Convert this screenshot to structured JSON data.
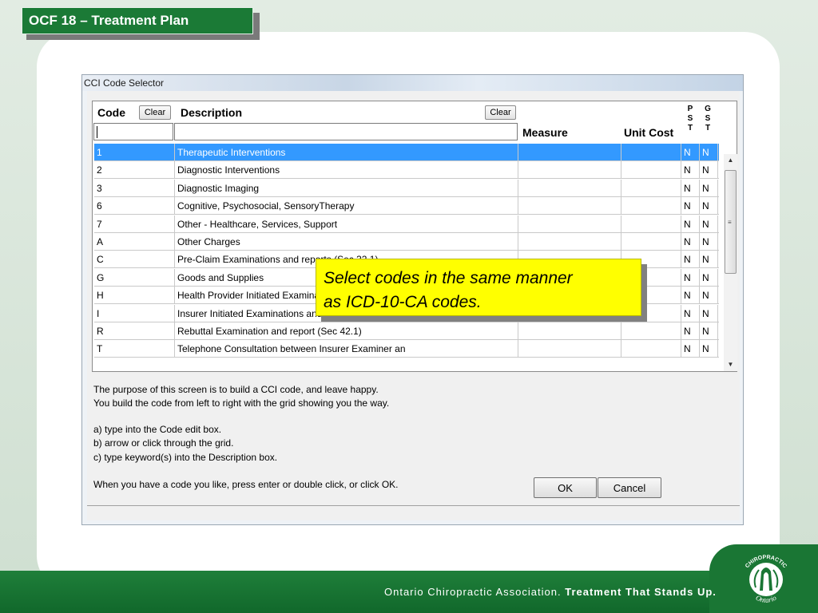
{
  "slide": {
    "title": "OCF 18 – Treatment Plan",
    "footer_org": "Ontario Chiropractic Association.",
    "footer_tagline": "Treatment That Stands Up.",
    "logo_text_top": "CHIROPRACTIC",
    "logo_text_bottom": "Ontario",
    "callout_line1": "Select codes in the same manner",
    "callout_line2": "as ICD-10-CA codes.",
    "colors": {
      "brand_green": "#1b7a36",
      "callout_yellow": "#ffff00",
      "selection_blue": "#3399ff"
    }
  },
  "dialog": {
    "title": "CCI Code Selector",
    "headers": {
      "code": "Code",
      "description": "Description",
      "measure": "Measure",
      "unit_cost": "Unit Cost",
      "pst": "P S T",
      "gst": "G S T"
    },
    "clear_code_label": "Clear",
    "clear_desc_label": "Clear",
    "code_input_value": "",
    "description_input_value": "",
    "rows": [
      {
        "code": "1",
        "description": "Therapeutic Interventions",
        "measure": "",
        "unit_cost": "",
        "pst": "N",
        "gst": "N",
        "selected": true
      },
      {
        "code": "2",
        "description": "Diagnostic Interventions",
        "measure": "",
        "unit_cost": "",
        "pst": "N",
        "gst": "N"
      },
      {
        "code": "3",
        "description": "Diagnostic Imaging",
        "measure": "",
        "unit_cost": "",
        "pst": "N",
        "gst": "N"
      },
      {
        "code": "6",
        "description": "Cognitive, Psychosocial, SensoryTherapy",
        "measure": "",
        "unit_cost": "",
        "pst": "N",
        "gst": "N"
      },
      {
        "code": "7",
        "description": "Other - Healthcare, Services, Support",
        "measure": "",
        "unit_cost": "",
        "pst": "N",
        "gst": "N"
      },
      {
        "code": "A",
        "description": "Other Charges",
        "measure": "",
        "unit_cost": "",
        "pst": "N",
        "gst": "N"
      },
      {
        "code": "C",
        "description": "Pre-Claim Examinations and reports (Sec 32.1)",
        "measure": "",
        "unit_cost": "",
        "pst": "N",
        "gst": "N"
      },
      {
        "code": "G",
        "description": "Goods and Supplies",
        "measure": "",
        "unit_cost": "",
        "pst": "N",
        "gst": "N"
      },
      {
        "code": "H",
        "description": "Health Provider Initiated Examinations and reports",
        "measure": "",
        "unit_cost": "",
        "pst": "N",
        "gst": "N"
      },
      {
        "code": "I",
        "description": "Insurer Initiated Examinations and reports (Sec 4",
        "measure": "",
        "unit_cost": "",
        "pst": "N",
        "gst": "N"
      },
      {
        "code": "R",
        "description": "Rebuttal Examination and report (Sec 42.1)",
        "measure": "",
        "unit_cost": "",
        "pst": "N",
        "gst": "N"
      },
      {
        "code": "T",
        "description": "Telephone Consultation between Insurer Examiner an",
        "measure": "",
        "unit_cost": "",
        "pst": "N",
        "gst": "N"
      }
    ],
    "help": {
      "line1": "The purpose of this screen is to build a CCI code, and leave happy.",
      "line2": "You build the code from left to right with the grid showing you the way.",
      "line3": "a) type into the Code edit box.",
      "line4": "b) arrow or click through the grid.",
      "line5": "c) type keyword(s) into the Description box.",
      "line6": "When you have a code you like, press enter or double click, or click OK."
    },
    "ok_label": "OK",
    "cancel_label": "Cancel",
    "scroll_up_icon": "scroll-up-arrow-icon",
    "scroll_down_icon": "scroll-down-arrow-icon"
  }
}
